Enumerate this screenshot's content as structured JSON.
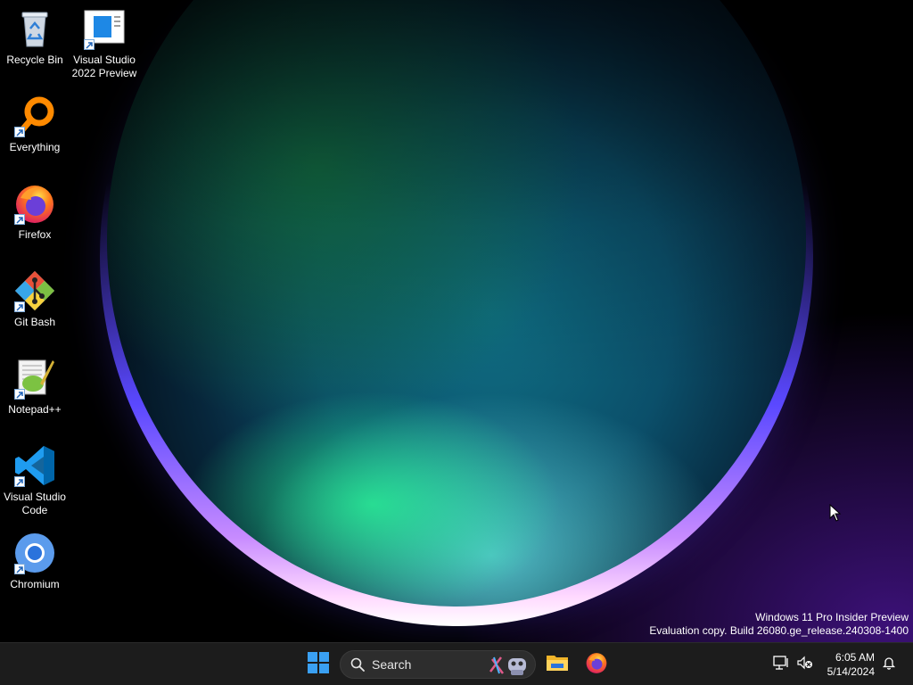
{
  "desktop": {
    "icons": [
      {
        "label": "Recycle Bin",
        "icon": "recycle-bin-icon"
      },
      {
        "label": "Visual Studio\n2022 Preview",
        "icon": "visual-studio-icon"
      },
      {
        "label": "Everything",
        "icon": "everything-search-icon"
      },
      {
        "label": "Firefox",
        "icon": "firefox-icon"
      },
      {
        "label": "Git Bash",
        "icon": "git-bash-icon"
      },
      {
        "label": "Notepad++",
        "icon": "notepad-plus-plus-icon"
      },
      {
        "label": "Visual Studio\nCode",
        "icon": "vscode-icon"
      },
      {
        "label": "Chromium",
        "icon": "chromium-icon"
      }
    ],
    "watermark": {
      "line1": "Windows 11 Pro Insider Preview",
      "line2": "Evaluation copy. Build 26080.ge_release.240308-1400"
    }
  },
  "taskbar": {
    "start_icon": "windows-start-icon",
    "search_placeholder": "Search",
    "pinned": [
      {
        "icon": "file-explorer-icon"
      },
      {
        "icon": "firefox-icon"
      }
    ],
    "tray": {
      "time": "6:05 AM",
      "date": "5/14/2024"
    }
  },
  "colors": {
    "taskbar_bg": "#1c1c1c",
    "accent": "#0078d4"
  }
}
